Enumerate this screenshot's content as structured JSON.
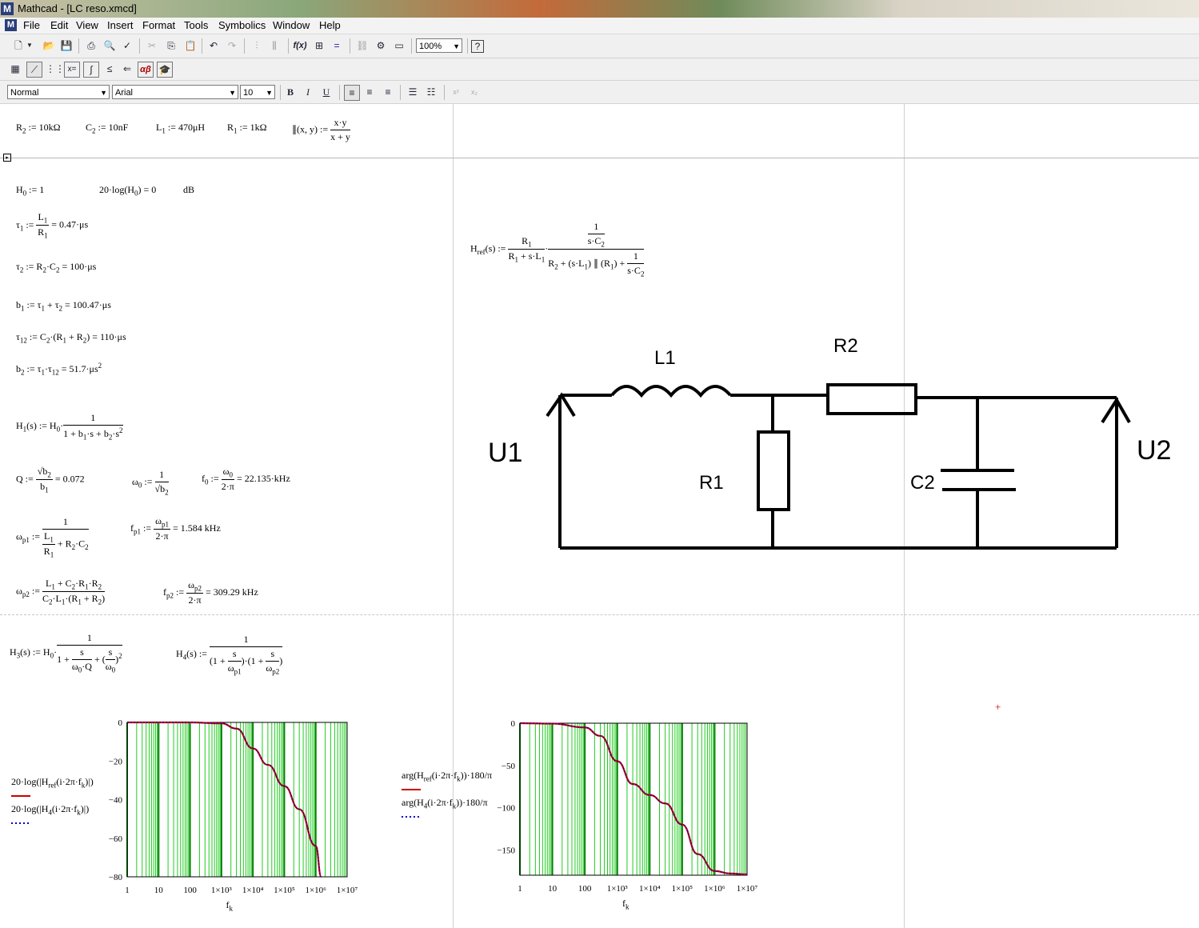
{
  "window": {
    "title": "Mathcad - [LC reso.xmcd]",
    "app_icon": "mathcad-icon"
  },
  "menu": [
    "File",
    "Edit",
    "View",
    "Insert",
    "Format",
    "Tools",
    "Symbolics",
    "Window",
    "Help"
  ],
  "toolbar": {
    "zoom": "100%",
    "style": "Normal",
    "font": "Arial",
    "size": "10",
    "bold": "B",
    "italic": "I",
    "underline": "U",
    "formula_btn": "f(x)",
    "alpha_btn": "αβ",
    "xeq_btn": "x="
  },
  "params": {
    "R2": "R<sub>2</sub> := 10kΩ",
    "C2": "C<sub>2</sub> := 10nF",
    "L1": "L<sub>1</sub> := 470μH",
    "R1": "R<sub>1</sub> := 1kΩ"
  },
  "equations": {
    "H0": "H<sub>0</sub> := 1",
    "H0db": "20·log(H<sub>0</sub>) = 0",
    "H0unit": "dB",
    "tau1_lhs": "τ<sub>1</sub> :=",
    "tau1_res": "= 0.47·μs",
    "tau2": "τ<sub>2</sub> := R<sub>2</sub>·C<sub>2</sub> = 100·μs",
    "b1": "b<sub>1</sub> := τ<sub>1</sub> + τ<sub>2</sub> = 100.47·μs",
    "tau12": "τ<sub>12</sub> := C<sub>2</sub>·(R<sub>1</sub> + R<sub>2</sub>) = 110·μs",
    "b2": "b<sub>2</sub> := τ<sub>1</sub>·τ<sub>12</sub> = 51.7·μs<sup>2</sup>",
    "Q_res": "= 0.072",
    "f0_res": "= 22.135·kHz",
    "fp1_res": "= 1.584 kHz",
    "fp2_res": "= 309.29 kHz"
  },
  "circuit": {
    "labels": [
      "L1",
      "R2",
      "U1",
      "R1",
      "C2",
      "U2"
    ]
  },
  "chart_data": [
    {
      "type": "line",
      "x_scale": "log",
      "x": [
        1,
        10,
        100,
        1000,
        3000,
        10000,
        30000,
        100000,
        300000,
        1000000,
        1500000
      ],
      "xlim": [
        1,
        10000000
      ],
      "ylim": [
        -80,
        0
      ],
      "xticks": [
        "1",
        "10",
        "100",
        "1×10³",
        "1×10⁴",
        "1×10⁵",
        "1×10⁶",
        "1×10⁷"
      ],
      "yticks": [
        "0",
        "−20",
        "−40",
        "−60",
        "−80"
      ],
      "xlabel": "f<sub>k</sub>",
      "series": [
        {
          "name": "20·log(|H<sub>ref</sub>(i·2π·f<sub>k</sub>)|)",
          "color": "#cc0000",
          "values": [
            0,
            0,
            0,
            -0.5,
            -3.2,
            -13.5,
            -22,
            -33,
            -45,
            -64,
            -80
          ]
        },
        {
          "name": "20·log(|H<sub>4</sub>(i·2π·f<sub>k</sub>)|)",
          "color": "#0000cc",
          "values": [
            0,
            0,
            0,
            -0.5,
            -3.2,
            -13.5,
            -22,
            -33,
            -45,
            -64,
            -80
          ]
        }
      ],
      "grid": true
    },
    {
      "type": "line",
      "x_scale": "log",
      "x": [
        1,
        10,
        100,
        300,
        1000,
        3000,
        10000,
        30000,
        100000,
        300000,
        1000000,
        3000000,
        10000000
      ],
      "xlim": [
        1,
        10000000
      ],
      "ylim": [
        -180,
        0
      ],
      "xticks": [
        "1",
        "10",
        "100",
        "1×10³",
        "1×10⁴",
        "1×10⁵",
        "1×10⁶",
        "1×10⁷"
      ],
      "yticks": [
        "0",
        "−50",
        "−100",
        "−150"
      ],
      "xlabel": "f<sub>k</sub>",
      "series": [
        {
          "name": "arg(H<sub>ref</sub>(i·2π·f<sub>k</sub>))·180/π",
          "color": "#cc0000",
          "values": [
            0,
            -0.5,
            -5,
            -15,
            -45,
            -72,
            -85,
            -95,
            -120,
            -155,
            -175,
            -178,
            -179
          ]
        },
        {
          "name": "arg(H<sub>4</sub>(i·2π·f<sub>k</sub>))·180/π",
          "color": "#0000cc",
          "values": [
            0,
            -0.5,
            -5,
            -15,
            -45,
            -72,
            -85,
            -95,
            -120,
            -155,
            -175,
            -178,
            -179
          ]
        }
      ],
      "grid": true
    }
  ]
}
